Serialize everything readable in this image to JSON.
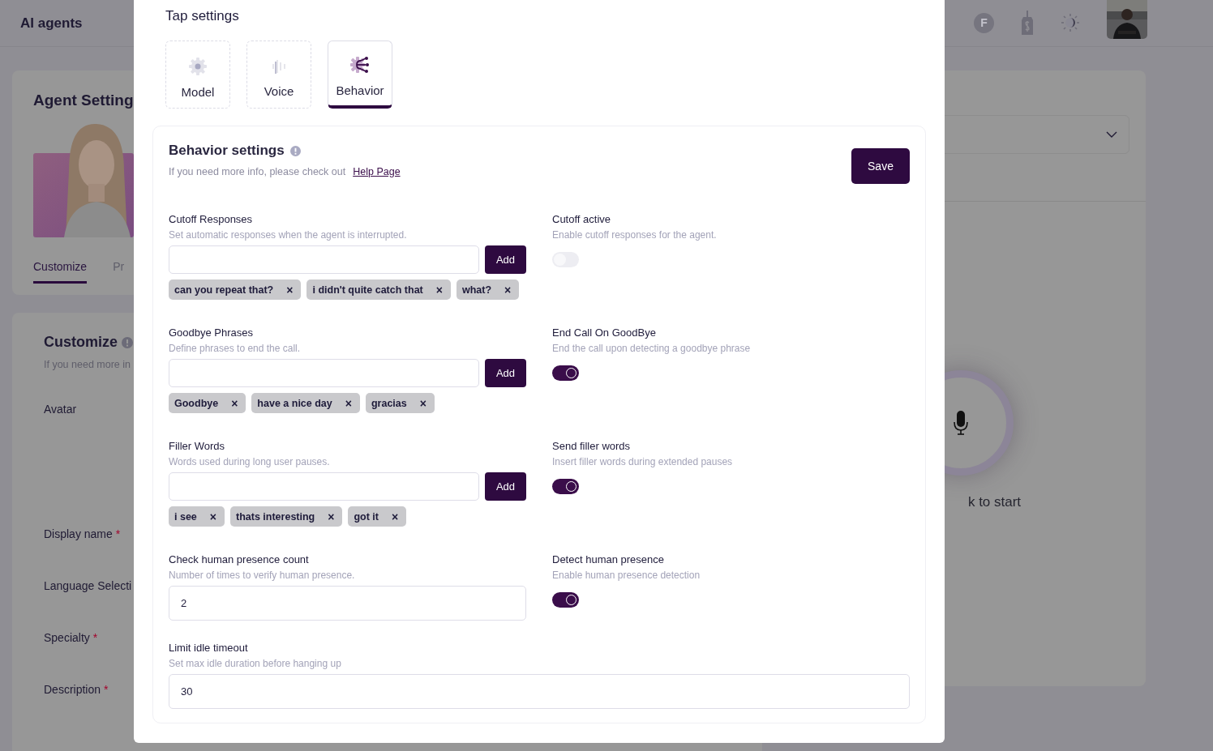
{
  "app": {
    "title": "AI agents"
  },
  "header": {
    "account_initial": "F"
  },
  "agent_panel": {
    "title": "Agent Setting",
    "tabs": [
      {
        "label": "Customize",
        "selected": true
      },
      {
        "label": "Pr",
        "selected": false
      }
    ]
  },
  "customize_panel": {
    "title": "Customize",
    "subtitle": "If you need more in",
    "fields": [
      {
        "label": "Avatar",
        "kind": "avatar"
      },
      {
        "label": "Display name",
        "required_mark": "*"
      },
      {
        "label": "Language Selecti"
      },
      {
        "label": "Specialty",
        "required_mark": "*"
      },
      {
        "label": "Description",
        "required_mark": "*"
      }
    ]
  },
  "call_panel": {
    "prompt": "k to start"
  },
  "modal": {
    "title": "Tap settings",
    "tabs": [
      {
        "label": "Model",
        "kind": "model",
        "selected": false
      },
      {
        "label": "Voice",
        "kind": "voice",
        "selected": false
      },
      {
        "label": "Behavior",
        "kind": "behavior",
        "selected": true
      }
    ],
    "section": {
      "title": "Behavior settings",
      "subtitle": "If you need more info, please check out",
      "link": "Help Page",
      "save": "Save",
      "settings": [
        {
          "kind": "list",
          "label": "Cutoff Responses",
          "description": "Set automatic responses when the agent is interrupted.",
          "button": "Add",
          "chips": [
            {
              "text": "can you repeat that?",
              "remove": "×"
            },
            {
              "text": "i didn't quite catch that",
              "remove": "×"
            },
            {
              "text": "what?",
              "remove": "×"
            }
          ]
        },
        {
          "kind": "toggle",
          "label": "Cutoff active",
          "description": "Enable cutoff responses for the agent.",
          "on": false
        },
        {
          "kind": "list",
          "label": "Goodbye Phrases",
          "description": "Define phrases to end the call.",
          "button": "Add",
          "chips": [
            {
              "text": "Goodbye",
              "remove": "×"
            },
            {
              "text": "have a nice day",
              "remove": "×"
            },
            {
              "text": "gracias",
              "remove": "×"
            }
          ]
        },
        {
          "kind": "toggle",
          "label": "End Call On GoodBye",
          "description": "End the call upon detecting a goodbye phrase",
          "on": true
        },
        {
          "kind": "list",
          "label": "Filler Words",
          "description": "Words used during long user pauses.",
          "button": "Add",
          "chips": [
            {
              "text": "i see",
              "remove": "×"
            },
            {
              "text": "thats interesting",
              "remove": "×"
            },
            {
              "text": "got it",
              "remove": "×"
            }
          ]
        },
        {
          "kind": "toggle",
          "label": "Send filler words",
          "description": "Insert filler words during extended pauses",
          "on": true
        },
        {
          "kind": "number",
          "label": "Check human presence count",
          "description": "Number of times to verify human presence.",
          "value": "2"
        },
        {
          "kind": "toggle",
          "label": "Detect human presence",
          "description": "Enable human presence detection",
          "on": true
        },
        {
          "kind": "number",
          "label": "Limit idle timeout",
          "description": "Set max idle duration before hanging up",
          "value": "30",
          "wide": true
        }
      ]
    }
  }
}
